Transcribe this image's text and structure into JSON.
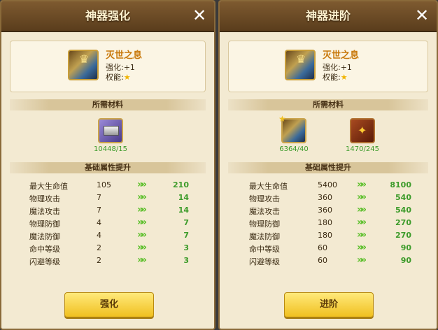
{
  "left": {
    "title": "神器强化",
    "close_icon": "close-icon",
    "item": {
      "name": "灭世之息",
      "level_line": "强化:+1",
      "perm_label": "权能:",
      "perm_star": "★"
    },
    "materials_header": "所需材料",
    "materials": [
      {
        "icon": "silver-bar-icon",
        "count": "10448/15"
      }
    ],
    "stats_header": "基础属性提升",
    "stats": [
      {
        "name": "最大生命值",
        "value": "105",
        "new": "210"
      },
      {
        "name": "物理攻击",
        "value": "7",
        "new": "14"
      },
      {
        "name": "魔法攻击",
        "value": "7",
        "new": "14"
      },
      {
        "name": "物理防御",
        "value": "4",
        "new": "7"
      },
      {
        "name": "魔法防御",
        "value": "4",
        "new": "7"
      },
      {
        "name": "命中等级",
        "value": "2",
        "new": "3"
      },
      {
        "name": "闪避等级",
        "value": "2",
        "new": "3"
      }
    ],
    "arrow": "»»",
    "button_label": "强化"
  },
  "right": {
    "title": "神器进阶",
    "close_icon": "close-icon",
    "item": {
      "name": "灭世之息",
      "level_line": "强化:+1",
      "perm_label": "权能:",
      "perm_star": "★"
    },
    "materials_header": "所需材料",
    "materials": [
      {
        "icon": "artifact-icon",
        "count": "6364/40"
      },
      {
        "icon": "red-crystal-icon",
        "count": "1470/245"
      }
    ],
    "stats_header": "基础属性提升",
    "stats": [
      {
        "name": "最大生命值",
        "value": "5400",
        "new": "8100"
      },
      {
        "name": "物理攻击",
        "value": "360",
        "new": "540"
      },
      {
        "name": "魔法攻击",
        "value": "360",
        "new": "540"
      },
      {
        "name": "物理防御",
        "value": "180",
        "new": "270"
      },
      {
        "name": "魔法防御",
        "value": "180",
        "new": "270"
      },
      {
        "name": "命中等级",
        "value": "60",
        "new": "90"
      },
      {
        "name": "闪避等级",
        "value": "60",
        "new": "90"
      }
    ],
    "arrow": "»»",
    "button_label": "进阶"
  }
}
